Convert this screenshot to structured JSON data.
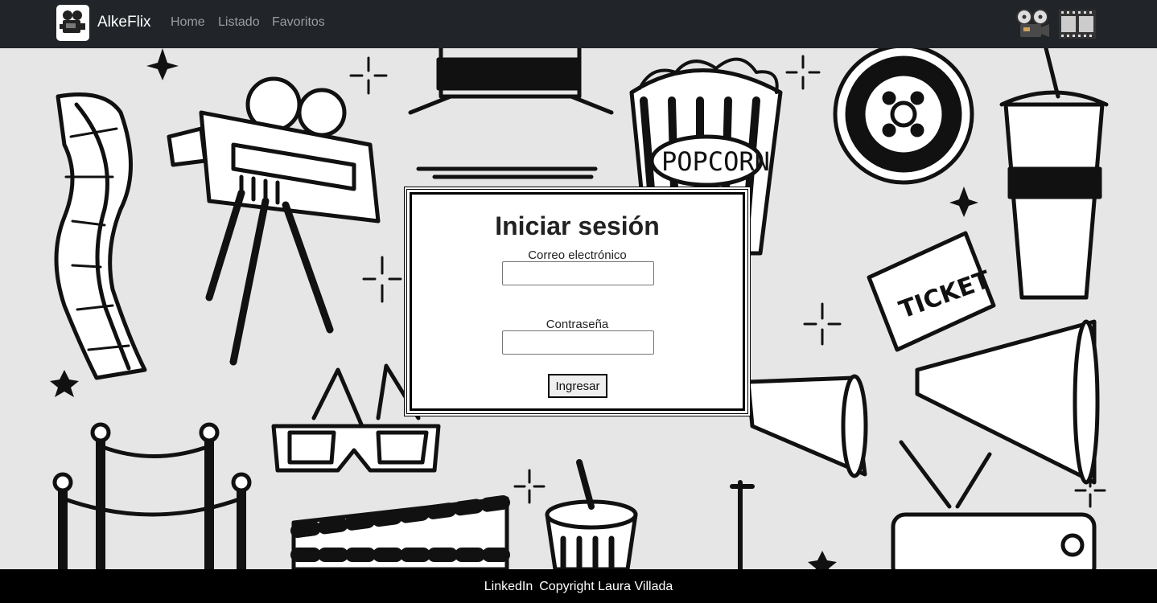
{
  "navbar": {
    "brand": "AlkeFlix",
    "links": [
      {
        "label": "Home"
      },
      {
        "label": "Listado"
      },
      {
        "label": "Favoritos"
      }
    ],
    "icons": [
      "movie-camera-icon",
      "film-projector-icon",
      "film-strip-icon"
    ]
  },
  "login": {
    "title": "Iniciar sesión",
    "email_label": "Correo electrónico",
    "email_value": "",
    "password_label": "Contraseña",
    "password_value": "",
    "submit_label": "Ingresar"
  },
  "background": {
    "popcorn_text": "POPCORN",
    "ticket_text": "TICKET"
  },
  "footer": {
    "link_label": "LinkedIn",
    "copyright": "Copyright Laura Villada"
  },
  "colors": {
    "navbar_bg": "#212529",
    "nav_link": "#9a9da0",
    "page_bg": "#e6e6e6",
    "footer_bg": "#000000"
  }
}
